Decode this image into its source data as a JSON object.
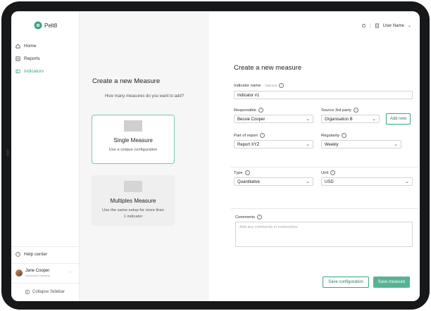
{
  "app": {
    "logo_text": "Pelt8"
  },
  "sidebar": {
    "items": [
      {
        "label": "Home",
        "icon": "home-icon"
      },
      {
        "label": "Reports",
        "icon": "reports-icon"
      },
      {
        "label": "Indicators",
        "icon": "indicators-icon",
        "active": true
      }
    ],
    "help_label": "Help center",
    "user": {
      "name": "Jane Cooper",
      "company": "Universal Company"
    },
    "collapse_label": "Collapse Sidebar"
  },
  "topbar": {
    "user_label": "User Name"
  },
  "left_panel": {
    "title": "Create a new Measure",
    "subtitle": "How many measures do you want to add?",
    "cards": [
      {
        "title": "Single Measure",
        "description": "Use a unique configuration"
      },
      {
        "title": "Multiples Measure",
        "description": "Use the same setup for more than 1 indicator"
      }
    ]
  },
  "form": {
    "title": "Create a new measure",
    "indicator_name": {
      "label": "Indicator name",
      "optional": "- Optional",
      "value": "Indicator #1"
    },
    "responsible": {
      "label": "Responsible",
      "value": "Bessie Cooper"
    },
    "source": {
      "label": "Source 3rd party",
      "value": "Organisation B"
    },
    "add_new_label": "Add new",
    "part_of_report": {
      "label": "Part of report",
      "value": "Report XYZ"
    },
    "regularity": {
      "label": "Regularity",
      "value": "Weekly"
    },
    "type": {
      "label": "Type",
      "value": "Quantitative"
    },
    "unit": {
      "label": "Unit",
      "value": "USD"
    },
    "comments": {
      "label": "Comments",
      "placeholder": "Add any comments or instructions"
    },
    "save_configuration_label": "Save configuration",
    "save_measure_label": "Save measure"
  },
  "colors": {
    "accent": "#56b392",
    "accent_dark": "#2f7f62",
    "panel_bg": "#f6f6f6"
  }
}
